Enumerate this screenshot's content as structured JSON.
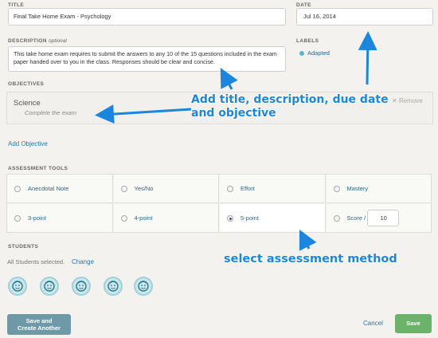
{
  "form": {
    "title_label": "TITLE",
    "title_value": "Final Take Home Exam - Psychology",
    "date_label": "DATE",
    "date_value": "Jul 16, 2014",
    "description_label": "DESCRIPTION",
    "description_optional": "optional",
    "description_value": "This take home exam requires to submit the answers to any 10 of the 15 questions included in the exam paper handed over to you in the class. Responses should be clear and concise.",
    "labels_label": "LABELS",
    "label_tag": "Adapted",
    "objectives_label": "OBJECTIVES",
    "objective_title": "Science",
    "objective_subtitle": "Complete the exam",
    "remove_label": "Remove",
    "add_objective": "Add Objective"
  },
  "assessment": {
    "label": "ASSESSMENT TOOLS",
    "row1": [
      "Anecdotal Note",
      "Yes/No",
      "Effort",
      "Mastery"
    ],
    "row2": [
      "3-point",
      "4-point",
      "5-point",
      "Score /"
    ],
    "score_value": "10",
    "selected": "5-point"
  },
  "students": {
    "label": "STUDENTS",
    "selected_text": "All Students selected.",
    "change_label": "Change"
  },
  "footer": {
    "save_create_line1": "Save and",
    "save_create_line2": "Create Another",
    "cancel_label": "Cancel",
    "save_label": "Save"
  },
  "annotations": {
    "top_line1": "Add title, description, due date",
    "top_line2": "and objective",
    "bottom": "select assessment method"
  },
  "colors": {
    "accent_link": "#2a7aa8",
    "annotation": "#1a86e0",
    "save_green": "#6bb36b",
    "save_create_teal": "#6e9aa8",
    "label_dot": "#5fb3c8"
  }
}
